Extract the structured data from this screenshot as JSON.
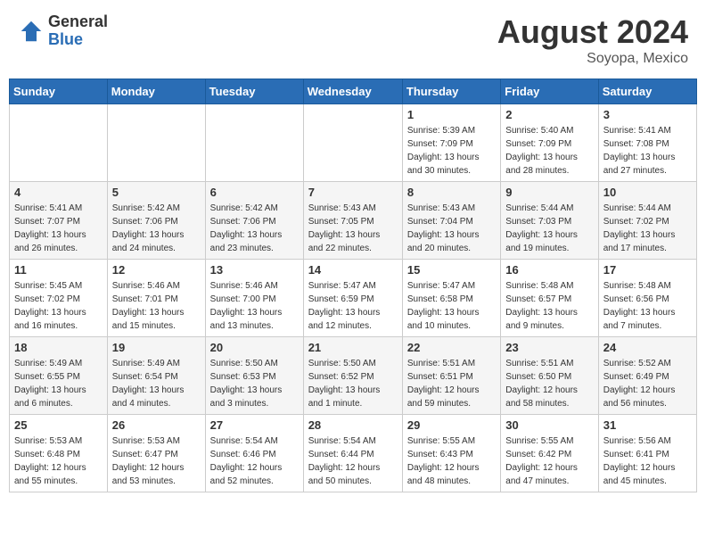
{
  "header": {
    "logo_general": "General",
    "logo_blue": "Blue",
    "month_title": "August 2024",
    "location": "Soyopa, Mexico"
  },
  "weekdays": [
    "Sunday",
    "Monday",
    "Tuesday",
    "Wednesday",
    "Thursday",
    "Friday",
    "Saturday"
  ],
  "weeks": [
    [
      {
        "day": "",
        "info": ""
      },
      {
        "day": "",
        "info": ""
      },
      {
        "day": "",
        "info": ""
      },
      {
        "day": "",
        "info": ""
      },
      {
        "day": "1",
        "info": "Sunrise: 5:39 AM\nSunset: 7:09 PM\nDaylight: 13 hours\nand 30 minutes."
      },
      {
        "day": "2",
        "info": "Sunrise: 5:40 AM\nSunset: 7:09 PM\nDaylight: 13 hours\nand 28 minutes."
      },
      {
        "day": "3",
        "info": "Sunrise: 5:41 AM\nSunset: 7:08 PM\nDaylight: 13 hours\nand 27 minutes."
      }
    ],
    [
      {
        "day": "4",
        "info": "Sunrise: 5:41 AM\nSunset: 7:07 PM\nDaylight: 13 hours\nand 26 minutes."
      },
      {
        "day": "5",
        "info": "Sunrise: 5:42 AM\nSunset: 7:06 PM\nDaylight: 13 hours\nand 24 minutes."
      },
      {
        "day": "6",
        "info": "Sunrise: 5:42 AM\nSunset: 7:06 PM\nDaylight: 13 hours\nand 23 minutes."
      },
      {
        "day": "7",
        "info": "Sunrise: 5:43 AM\nSunset: 7:05 PM\nDaylight: 13 hours\nand 22 minutes."
      },
      {
        "day": "8",
        "info": "Sunrise: 5:43 AM\nSunset: 7:04 PM\nDaylight: 13 hours\nand 20 minutes."
      },
      {
        "day": "9",
        "info": "Sunrise: 5:44 AM\nSunset: 7:03 PM\nDaylight: 13 hours\nand 19 minutes."
      },
      {
        "day": "10",
        "info": "Sunrise: 5:44 AM\nSunset: 7:02 PM\nDaylight: 13 hours\nand 17 minutes."
      }
    ],
    [
      {
        "day": "11",
        "info": "Sunrise: 5:45 AM\nSunset: 7:02 PM\nDaylight: 13 hours\nand 16 minutes."
      },
      {
        "day": "12",
        "info": "Sunrise: 5:46 AM\nSunset: 7:01 PM\nDaylight: 13 hours\nand 15 minutes."
      },
      {
        "day": "13",
        "info": "Sunrise: 5:46 AM\nSunset: 7:00 PM\nDaylight: 13 hours\nand 13 minutes."
      },
      {
        "day": "14",
        "info": "Sunrise: 5:47 AM\nSunset: 6:59 PM\nDaylight: 13 hours\nand 12 minutes."
      },
      {
        "day": "15",
        "info": "Sunrise: 5:47 AM\nSunset: 6:58 PM\nDaylight: 13 hours\nand 10 minutes."
      },
      {
        "day": "16",
        "info": "Sunrise: 5:48 AM\nSunset: 6:57 PM\nDaylight: 13 hours\nand 9 minutes."
      },
      {
        "day": "17",
        "info": "Sunrise: 5:48 AM\nSunset: 6:56 PM\nDaylight: 13 hours\nand 7 minutes."
      }
    ],
    [
      {
        "day": "18",
        "info": "Sunrise: 5:49 AM\nSunset: 6:55 PM\nDaylight: 13 hours\nand 6 minutes."
      },
      {
        "day": "19",
        "info": "Sunrise: 5:49 AM\nSunset: 6:54 PM\nDaylight: 13 hours\nand 4 minutes."
      },
      {
        "day": "20",
        "info": "Sunrise: 5:50 AM\nSunset: 6:53 PM\nDaylight: 13 hours\nand 3 minutes."
      },
      {
        "day": "21",
        "info": "Sunrise: 5:50 AM\nSunset: 6:52 PM\nDaylight: 13 hours\nand 1 minute."
      },
      {
        "day": "22",
        "info": "Sunrise: 5:51 AM\nSunset: 6:51 PM\nDaylight: 12 hours\nand 59 minutes."
      },
      {
        "day": "23",
        "info": "Sunrise: 5:51 AM\nSunset: 6:50 PM\nDaylight: 12 hours\nand 58 minutes."
      },
      {
        "day": "24",
        "info": "Sunrise: 5:52 AM\nSunset: 6:49 PM\nDaylight: 12 hours\nand 56 minutes."
      }
    ],
    [
      {
        "day": "25",
        "info": "Sunrise: 5:53 AM\nSunset: 6:48 PM\nDaylight: 12 hours\nand 55 minutes."
      },
      {
        "day": "26",
        "info": "Sunrise: 5:53 AM\nSunset: 6:47 PM\nDaylight: 12 hours\nand 53 minutes."
      },
      {
        "day": "27",
        "info": "Sunrise: 5:54 AM\nSunset: 6:46 PM\nDaylight: 12 hours\nand 52 minutes."
      },
      {
        "day": "28",
        "info": "Sunrise: 5:54 AM\nSunset: 6:44 PM\nDaylight: 12 hours\nand 50 minutes."
      },
      {
        "day": "29",
        "info": "Sunrise: 5:55 AM\nSunset: 6:43 PM\nDaylight: 12 hours\nand 48 minutes."
      },
      {
        "day": "30",
        "info": "Sunrise: 5:55 AM\nSunset: 6:42 PM\nDaylight: 12 hours\nand 47 minutes."
      },
      {
        "day": "31",
        "info": "Sunrise: 5:56 AM\nSunset: 6:41 PM\nDaylight: 12 hours\nand 45 minutes."
      }
    ]
  ]
}
